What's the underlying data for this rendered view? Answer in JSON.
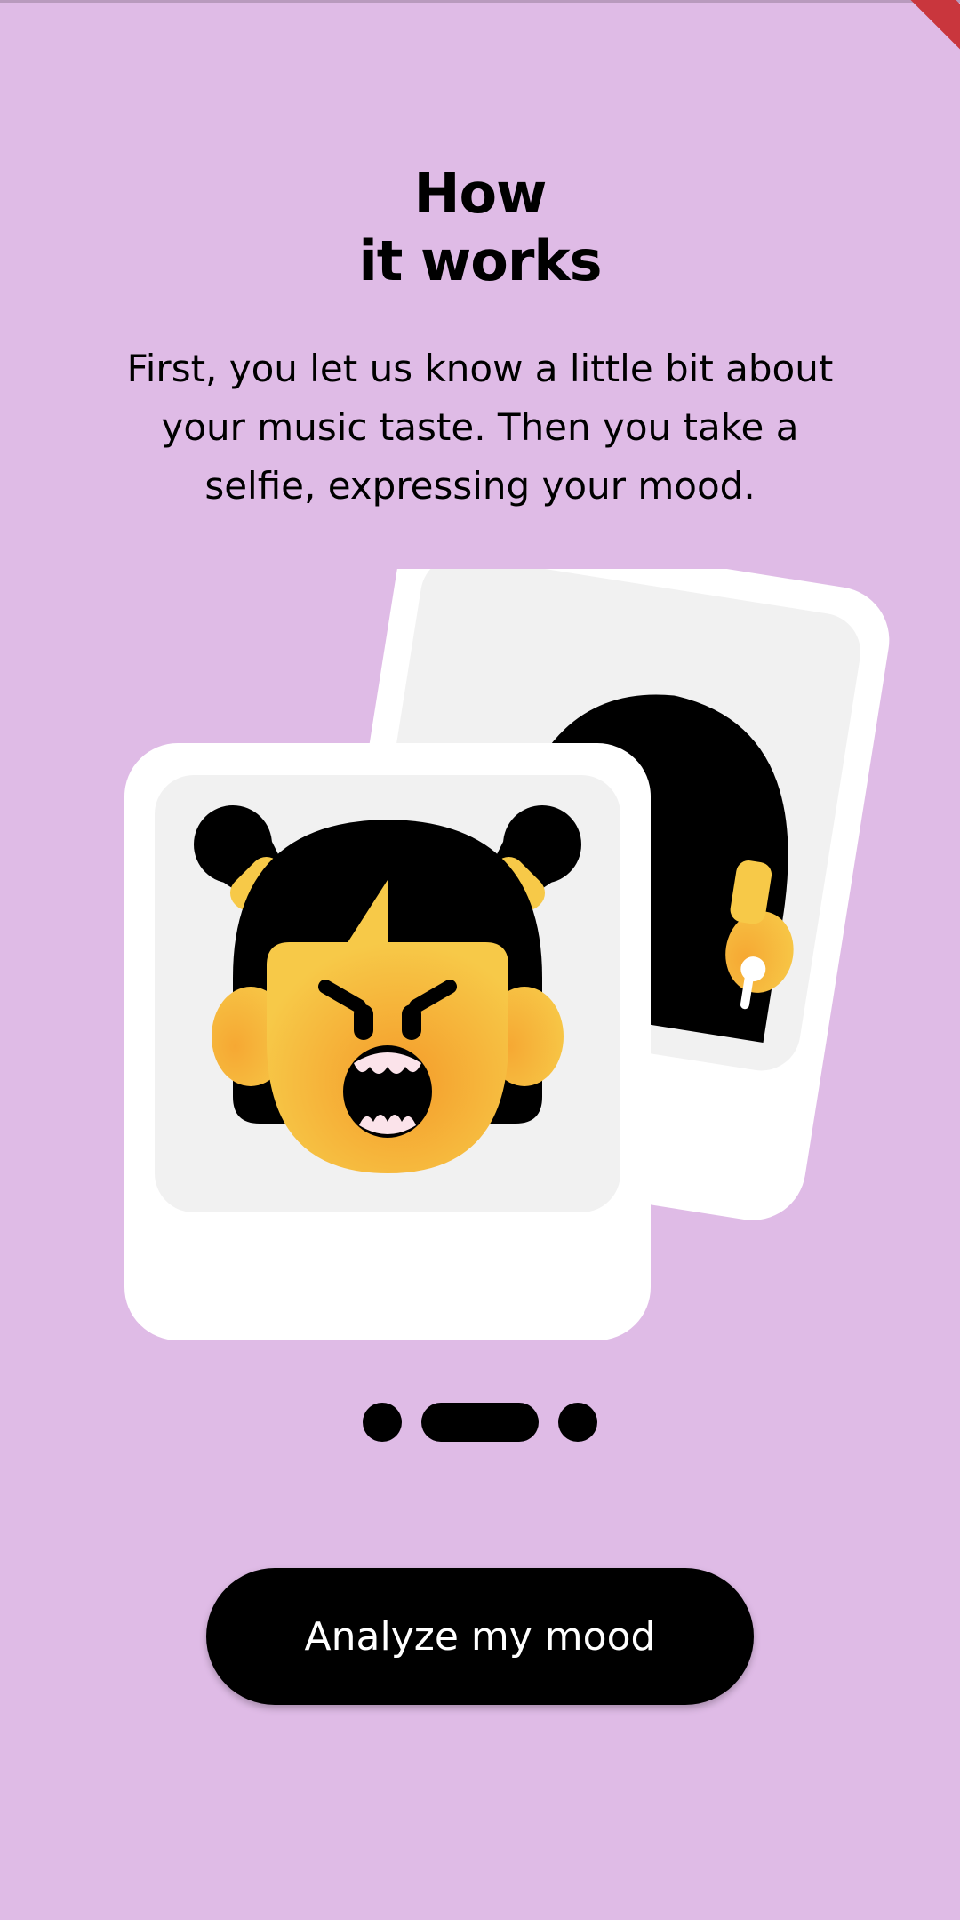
{
  "onboarding": {
    "title_line1": "How",
    "title_line2": "it works",
    "description": "First, you let us know a little bit about your music taste. Then you take a selfie, expressing your mood.",
    "cta_label": "Analyze my mood"
  },
  "pager": {
    "page_count": 3,
    "active_index": 1
  },
  "colors": {
    "background": "#DFBBE6",
    "button": "#000000",
    "button_text": "#FFFFFF",
    "face": "#F7C948",
    "face_shade": "#F49B2A",
    "card": "#FFFFFF",
    "card_inner": "#F1F1F1"
  }
}
